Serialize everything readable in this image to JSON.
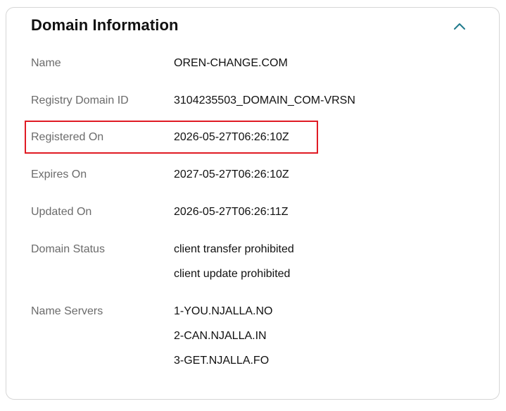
{
  "panel": {
    "title": "Domain Information",
    "collapse_icon": "chevron-up-icon",
    "accent_color": "#1f7a8c",
    "highlight_color": "#e01b24"
  },
  "fields": {
    "name": {
      "label": "Name",
      "value": "OREN-CHANGE.COM"
    },
    "registry_domain_id": {
      "label": "Registry Domain ID",
      "value": "3104235503_DOMAIN_COM-VRSN"
    },
    "registered_on": {
      "label": "Registered On",
      "value": "2026-05-27T06:26:10Z"
    },
    "expires_on": {
      "label": "Expires On",
      "value": "2027-05-27T06:26:10Z"
    },
    "updated_on": {
      "label": "Updated On",
      "value": "2026-05-27T06:26:11Z"
    },
    "domain_status": {
      "label": "Domain Status",
      "values": [
        "client transfer prohibited",
        "client update prohibited"
      ]
    },
    "name_servers": {
      "label": "Name Servers",
      "values": [
        "1-YOU.NJALLA.NO",
        "2-CAN.NJALLA.IN",
        "3-GET.NJALLA.FO"
      ]
    }
  }
}
